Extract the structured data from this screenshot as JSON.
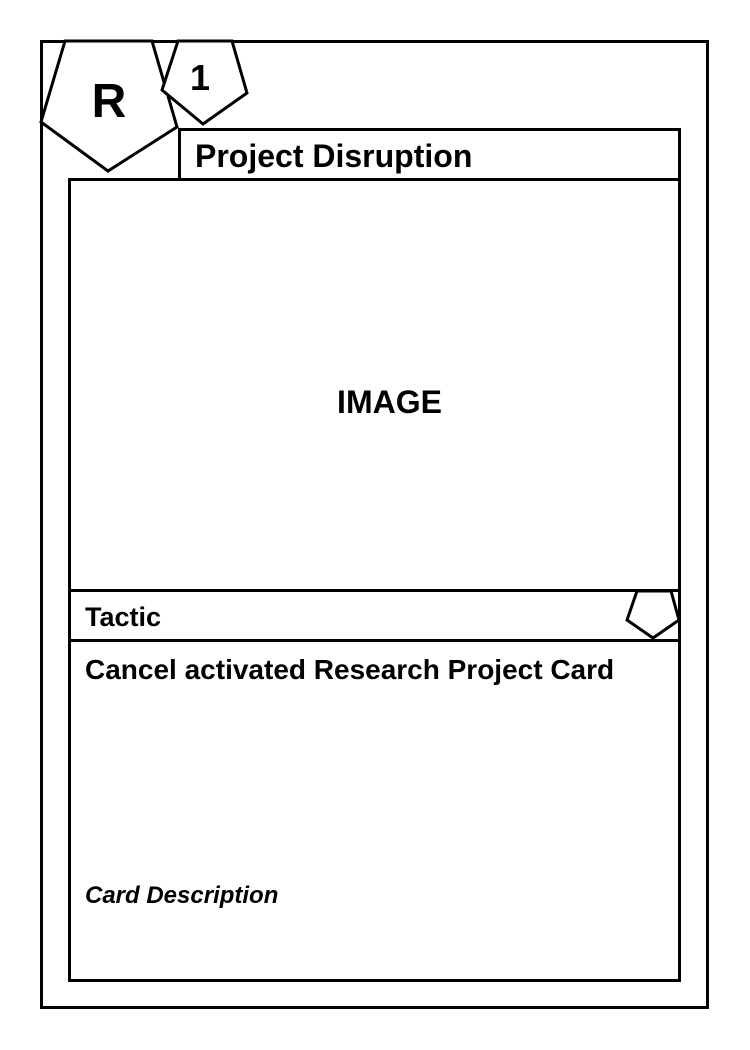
{
  "card": {
    "rarity_symbol": "R",
    "cost": "1",
    "title": "Project Disruption",
    "image_placeholder": "IMAGE",
    "type": "Tactic",
    "rules_text": "Cancel activated Research Project Card",
    "description": "Card Description"
  },
  "icons": {
    "rarity_badge": "pentagon-icon",
    "cost_badge": "pentagon-icon",
    "set_symbol": "pentagon-icon"
  },
  "colors": {
    "line": "#000000",
    "background": "#ffffff"
  }
}
